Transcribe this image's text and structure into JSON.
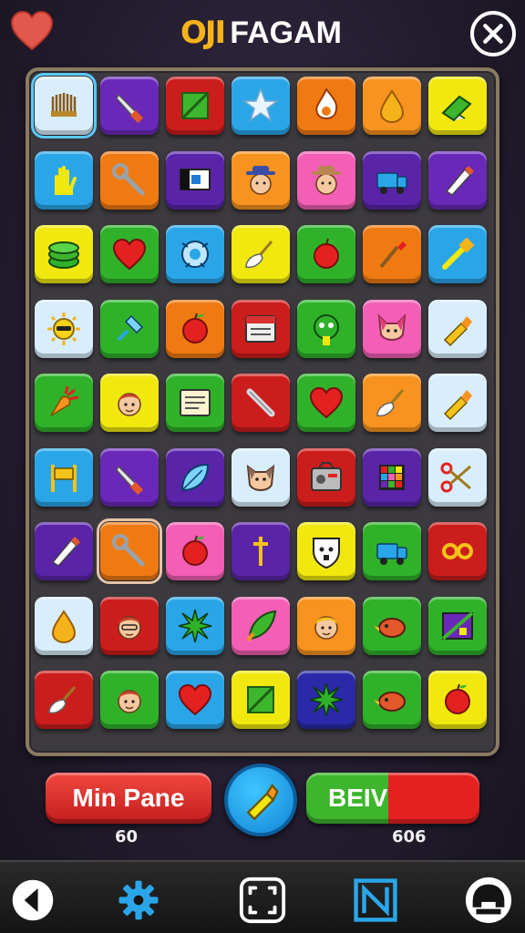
{
  "header": {
    "logo_mark": "ОЈI",
    "title": "FAGAM"
  },
  "board": {
    "rows": [
      [
        {
          "color": "#d9eefc",
          "icon": "crown-icon",
          "selected": true
        },
        {
          "color": "#6a28b8",
          "icon": "knife-icon"
        },
        {
          "color": "#cc1d1d",
          "icon": "square-slash-icon"
        },
        {
          "color": "#2aa6e8",
          "icon": "star-icon"
        },
        {
          "color": "#f07a12",
          "icon": "flame-icon"
        },
        {
          "color": "#f7931e",
          "icon": "droplet-icon"
        },
        {
          "color": "#f1e80f",
          "icon": "eraser-icon"
        }
      ],
      [
        {
          "color": "#2aa6e8",
          "icon": "hand-icon"
        },
        {
          "color": "#f07a12",
          "icon": "wrench-icon"
        },
        {
          "color": "#5a24a8",
          "icon": "flag-icon"
        },
        {
          "color": "#f7931e",
          "icon": "cowboy-face-icon"
        },
        {
          "color": "#f25fb4",
          "icon": "hat-face-icon"
        },
        {
          "color": "#5a24a8",
          "icon": "truck-icon"
        },
        {
          "color": "#6a28b8",
          "icon": "pen-icon"
        }
      ],
      [
        {
          "color": "#f1e80f",
          "icon": "coin-stack-icon"
        },
        {
          "color": "#2fb22a",
          "icon": "heart-icon"
        },
        {
          "color": "#2aa6e8",
          "icon": "robot-icon"
        },
        {
          "color": "#f1e80f",
          "icon": "feather-broom-icon"
        },
        {
          "color": "#2fb22a",
          "icon": "apple-icon"
        },
        {
          "color": "#f07a12",
          "icon": "brush-icon"
        },
        {
          "color": "#2aa6e8",
          "icon": "tool-icon"
        }
      ],
      [
        {
          "color": "#d9eefc",
          "icon": "sun-icon"
        },
        {
          "color": "#2fb22a",
          "icon": "pin-icon"
        },
        {
          "color": "#f07a12",
          "icon": "apple-icon"
        },
        {
          "color": "#cc1d1d",
          "icon": "calendar-icon"
        },
        {
          "color": "#2fb22a",
          "icon": "monster-icon"
        },
        {
          "color": "#f25fb4",
          "icon": "fox-face-icon"
        },
        {
          "color": "#d9eefc",
          "icon": "crayon-icon"
        }
      ],
      [
        {
          "color": "#2fb22a",
          "icon": "carrot-icon"
        },
        {
          "color": "#f1e80f",
          "icon": "boy-face-icon"
        },
        {
          "color": "#2fb22a",
          "icon": "notepad-icon"
        },
        {
          "color": "#cc1d1d",
          "icon": "pencil-icon"
        },
        {
          "color": "#2fb22a",
          "icon": "heart-icon"
        },
        {
          "color": "#f7931e",
          "icon": "feather-broom-icon"
        },
        {
          "color": "#d9eefc",
          "icon": "crayon-icon"
        }
      ],
      [
        {
          "color": "#2aa6e8",
          "icon": "gate-icon"
        },
        {
          "color": "#6a28b8",
          "icon": "knife-icon"
        },
        {
          "color": "#5a24a8",
          "icon": "leaf-icon"
        },
        {
          "color": "#d9eefc",
          "icon": "dog-face-icon"
        },
        {
          "color": "#cc1d1d",
          "icon": "radio-icon"
        },
        {
          "color": "#5a24a8",
          "icon": "block-grid-icon"
        },
        {
          "color": "#d9eefc",
          "icon": "scissors-icon"
        }
      ],
      [
        {
          "color": "#5a24a8",
          "icon": "pen-icon"
        },
        {
          "color": "#f07a12",
          "icon": "wrench-icon",
          "highlight": true
        },
        {
          "color": "#f25fb4",
          "icon": "apple-icon"
        },
        {
          "color": "#5a24a8",
          "icon": "dagger-icon"
        },
        {
          "color": "#f1e80f",
          "icon": "shield-face-icon"
        },
        {
          "color": "#2fb22a",
          "icon": "truck-icon"
        },
        {
          "color": "#cc1d1d",
          "icon": "rings-icon"
        }
      ],
      [
        {
          "color": "#d9eefc",
          "icon": "droplet-icon"
        },
        {
          "color": "#cc1d1d",
          "icon": "man-face-icon"
        },
        {
          "color": "#2aa6e8",
          "icon": "burst-icon"
        },
        {
          "color": "#f25fb4",
          "icon": "leaf-brush-icon"
        },
        {
          "color": "#f7931e",
          "icon": "blond-face-icon"
        },
        {
          "color": "#2fb22a",
          "icon": "bird-icon"
        },
        {
          "color": "#2fb22a",
          "icon": "map-icon"
        }
      ],
      [
        {
          "color": "#cc1d1d",
          "icon": "feather-broom-icon"
        },
        {
          "color": "#2fb22a",
          "icon": "boy-face-icon"
        },
        {
          "color": "#2aa6e8",
          "icon": "heart-icon"
        },
        {
          "color": "#f1e80f",
          "icon": "square-slash-icon"
        },
        {
          "color": "#2a2aa8",
          "icon": "burst-icon"
        },
        {
          "color": "#2fb22a",
          "icon": "bird-icon"
        },
        {
          "color": "#f1e80f",
          "icon": "apple-icon"
        }
      ]
    ]
  },
  "controls": {
    "left_button_label": "Min Pane",
    "right_button_label": "BEIV",
    "left_score": "60",
    "right_score": "606"
  },
  "nav": [
    {
      "icon": "back-icon"
    },
    {
      "icon": "gear-icon"
    },
    {
      "icon": "expand-icon"
    },
    {
      "icon": "n-logo-icon"
    },
    {
      "icon": "helmet-icon"
    }
  ]
}
